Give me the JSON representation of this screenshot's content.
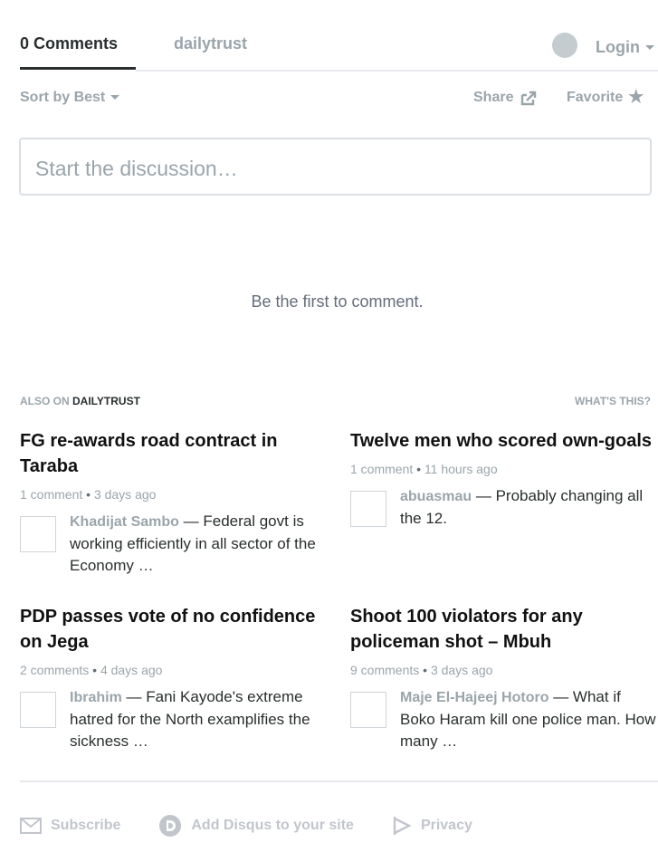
{
  "header": {
    "comments_tab": "0 Comments",
    "forum_tab": "dailytrust",
    "login_label": "Login"
  },
  "toolbar": {
    "sort_label": "Sort by Best",
    "share_label": "Share",
    "favorite_label": "Favorite"
  },
  "compose": {
    "placeholder": "Start the discussion…"
  },
  "empty_state": "Be the first to comment.",
  "also_on": {
    "prefix": "ALSO ON",
    "forum": "DAILYTRUST",
    "whats_this": "WHAT'S THIS?",
    "items": [
      {
        "title": "FG re-awards road contract in Taraba",
        "comments": "1 comment",
        "ago": "3 days ago",
        "author": "Khadijat Sambo",
        "excerpt": " — Federal govt is working efficiently in all sector of the Economy …"
      },
      {
        "title": "Twelve men who scored own-goals",
        "comments": "1 comment",
        "ago": "11 hours ago",
        "author": "abuasmau",
        "excerpt": " — Probably changing all the 12."
      },
      {
        "title": "PDP passes vote of no confidence on Jega",
        "comments": "2 comments",
        "ago": "4 days ago",
        "author": "Ibrahim",
        "excerpt": " — Fani Kayode's extreme hatred for the North examplifies the sickness …"
      },
      {
        "title": "Shoot 100 violators for any policeman shot – Mbuh",
        "comments": "9 comments",
        "ago": "3 days ago",
        "author": "Maje El-Hajeej Hotoro",
        "excerpt": " — What if Boko Haram kill one police man. How many …"
      }
    ]
  },
  "footer": {
    "subscribe": "Subscribe",
    "add_disqus": "Add Disqus to your site",
    "privacy": "Privacy"
  },
  "icons": {
    "avatar": "user-avatar-placeholder",
    "share": "share-out-icon",
    "favorite": "star-icon",
    "subscribe": "envelope-icon",
    "disqus": "disqus-logo-icon",
    "privacy": "privacy-play-icon"
  }
}
